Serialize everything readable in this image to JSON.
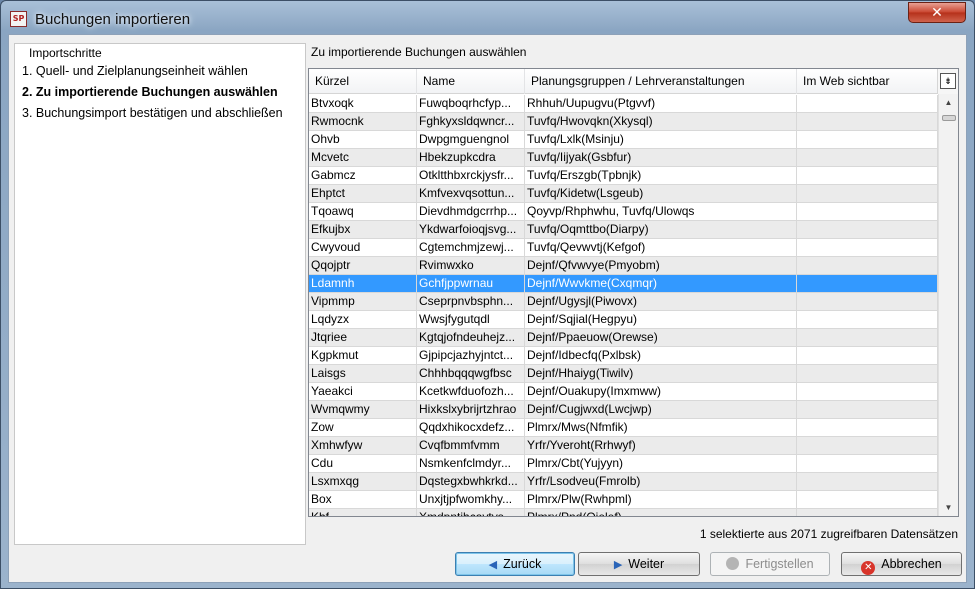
{
  "window": {
    "title": "Buchungen importieren",
    "app_icon": "SP",
    "close_icon": "close-icon"
  },
  "steps": {
    "title": "Importschritte",
    "items": [
      {
        "label": "1. Quell- und Zielplanungseinheit wählen",
        "active": false
      },
      {
        "label": "2. Zu importierende Buchungen auswählen",
        "active": true
      },
      {
        "label": "3. Buchungsimport bestätigen und abschließen",
        "active": false
      }
    ]
  },
  "main": {
    "title": "Zu importierende Buchungen auswählen",
    "columns": [
      "Kürzel",
      "Name",
      "Planungsgruppen / Lehrveranstaltungen",
      "Im Web sichtbar"
    ],
    "rows": [
      {
        "kuerzel": "Btvxoqk",
        "name": "Fuwqboqrhcfyp...",
        "gruppe": "Rhhuh/Uupugvu(Ptgvvf)",
        "web": true
      },
      {
        "kuerzel": "Rwmocnk",
        "name": "Fghkyxsldqwncr...",
        "gruppe": "Tuvfq/Hwovqkn(Xkysql)",
        "web": true
      },
      {
        "kuerzel": "Ohvb",
        "name": "Dwpgmguengnol",
        "gruppe": "Tuvfq/Lxlk(Msinju)",
        "web": true
      },
      {
        "kuerzel": "Mcvetc",
        "name": "Hbekzupkcdra",
        "gruppe": "Tuvfq/Iijyak(Gsbfur)",
        "web": true
      },
      {
        "kuerzel": "Gabmcz",
        "name": "Otkltthbxrckjysfr...",
        "gruppe": "Tuvfq/Erszgb(Tpbnjk)",
        "web": true
      },
      {
        "kuerzel": "Ehptct",
        "name": "Kmfvexvqsottun...",
        "gruppe": "Tuvfq/Kidetw(Lsgeub)",
        "web": true
      },
      {
        "kuerzel": "Tqoawq",
        "name": "Dievdhmdgcrrhp...",
        "gruppe": "Qoyvp/Rhphwhu, Tuvfq/Ulowqs",
        "web": true
      },
      {
        "kuerzel": "Efkujbx",
        "name": "Ykdwarfoioqjsvg...",
        "gruppe": "Tuvfq/Oqmttbo(Diarpy)",
        "web": true
      },
      {
        "kuerzel": "Cwyvoud",
        "name": "Cgtemchmjzewj...",
        "gruppe": "Tuvfq/Qevwvtj(Kefgof)",
        "web": true
      },
      {
        "kuerzel": "Qqojptr",
        "name": "Rvimwxko",
        "gruppe": "Dejnf/Qfvwvye(Pmyobm)",
        "web": true
      },
      {
        "kuerzel": "Ldamnh",
        "name": "Gchfjppwrnau",
        "gruppe": "Dejnf/Wwvkme(Cxqmqr)",
        "web": true,
        "selected": true
      },
      {
        "kuerzel": "Vipmmp",
        "name": "Cseprpnvbsphn...",
        "gruppe": "Dejnf/Ugysjl(Piwovx)",
        "web": true
      },
      {
        "kuerzel": "Lqdyzx",
        "name": "Wwsjfygutqdl",
        "gruppe": "Dejnf/Sqjial(Hegpyu)",
        "web": true
      },
      {
        "kuerzel": "Jtqriee",
        "name": "Kgtqjofndeuhejz...",
        "gruppe": "Dejnf/Ppaeuow(Orewse)",
        "web": true
      },
      {
        "kuerzel": "Kgpkmut",
        "name": "Gjpipcjazhyjntct...",
        "gruppe": "Dejnf/Idbecfq(Pxlbsk)",
        "web": true
      },
      {
        "kuerzel": "Laisgs",
        "name": "Chhhbqqqwgfbsc",
        "gruppe": "Dejnf/Hhaiyg(Tiwilv)",
        "web": true
      },
      {
        "kuerzel": "Yaeakci",
        "name": "Kcetkwfduofozh...",
        "gruppe": "Dejnf/Ouakupy(Imxmww)",
        "web": true
      },
      {
        "kuerzel": "Wvmqwmy",
        "name": "Hixkslxybrijrtzhrao",
        "gruppe": "Dejnf/Cugjwxd(Lwcjwp)",
        "web": true
      },
      {
        "kuerzel": "Zow",
        "name": "Qqdxhikocxdefz...",
        "gruppe": "Plmrx/Mws(Nfmfik)",
        "web": true
      },
      {
        "kuerzel": "Xmhwfyw",
        "name": "Cvqfbmmfvmm",
        "gruppe": "Yrfr/Yveroht(Rrhwyf)",
        "web": true
      },
      {
        "kuerzel": "Cdu",
        "name": "Nsmkenfclmdyr...",
        "gruppe": "Plmrx/Cbt(Yujyyn)",
        "web": true
      },
      {
        "kuerzel": "Lsxmxqg",
        "name": "Dqstegxbwhkrkd...",
        "gruppe": "Yrfr/Lsodveu(Fmrolb)",
        "web": true
      },
      {
        "kuerzel": "Box",
        "name": "Unxjtjpfwomkhy...",
        "gruppe": "Plmrx/Plw(Rwhpml)",
        "web": true
      },
      {
        "kuerzel": "Khf",
        "name": "Xmdpntihcavtvs",
        "gruppe": "Plmrx/Pnd(Ojelef)",
        "web": true
      }
    ],
    "status": "1 selektierte aus 2071 zugreifbaren Datensätzen"
  },
  "buttons": {
    "back": "Zurück",
    "next": "Weiter",
    "finish": "Fertigstellen",
    "cancel": "Abbrechen"
  }
}
